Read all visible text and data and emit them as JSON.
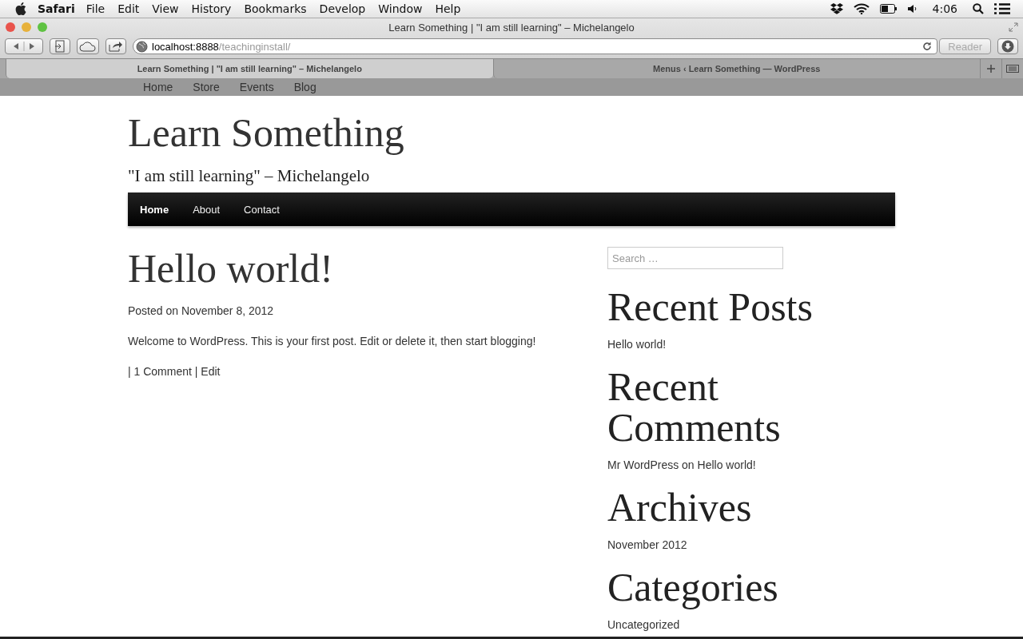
{
  "menubar": {
    "app": "Safari",
    "menus": [
      "File",
      "Edit",
      "View",
      "History",
      "Bookmarks",
      "Develop",
      "Window",
      "Help"
    ],
    "clock": "4:06"
  },
  "window": {
    "title": "Learn Something | \"I am still learning\" – Michelangelo",
    "url_host": "localhost:8888",
    "url_path": "/teachinginstall/",
    "reader": "Reader"
  },
  "tabs": [
    {
      "label": "Learn Something | \"I am still learning\" – Michelangelo",
      "selected": true
    },
    {
      "label": "Menus ‹ Learn Something — WordPress",
      "selected": false
    }
  ],
  "top_nav": [
    "Home",
    "Store",
    "Events",
    "Blog"
  ],
  "site": {
    "title": "Learn Something",
    "tagline": "\"I am still learning\" – Michelangelo"
  },
  "nav": [
    {
      "label": "Home",
      "selected": true
    },
    {
      "label": "About",
      "selected": false
    },
    {
      "label": "Contact",
      "selected": false
    }
  ],
  "post": {
    "title": "Hello world!",
    "posted_prefix": "Posted on",
    "date": "November 8, 2012",
    "content": "Welcome to WordPress. This is your first post. Edit or delete it, then start blogging!",
    "footer": "| 1 Comment | Edit"
  },
  "sidebar": {
    "search_placeholder": "Search …",
    "widgets": [
      {
        "title": "Recent Posts",
        "items": [
          "Hello world!"
        ]
      },
      {
        "title": "Recent Comments",
        "items": [
          "Mr WordPress on Hello world!"
        ]
      },
      {
        "title": "Archives",
        "items": [
          "November 2012"
        ]
      },
      {
        "title": "Categories",
        "items": [
          "Uncategorized"
        ]
      }
    ]
  }
}
